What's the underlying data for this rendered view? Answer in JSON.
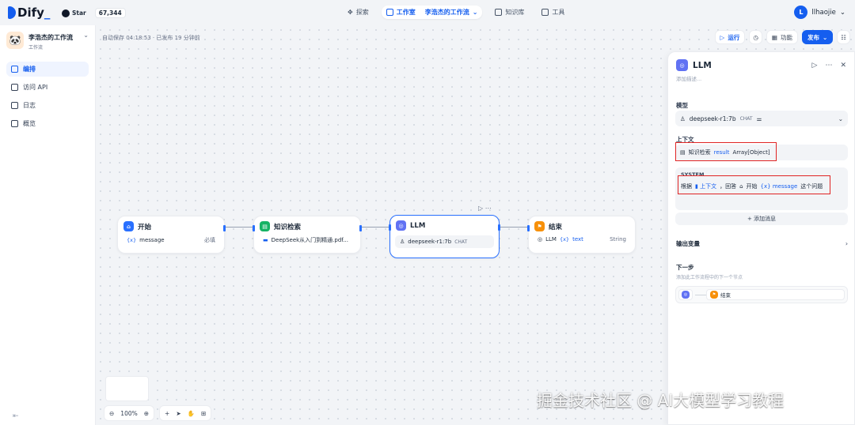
{
  "topbar": {
    "logo": "Dify",
    "github_star": "Star",
    "github_count": "67,344",
    "nav": [
      {
        "label": "探索",
        "icon": "compass-icon"
      },
      {
        "label": "工作室",
        "icon": "robot-icon",
        "sub": "李浩杰的工作流"
      },
      {
        "label": "知识库",
        "icon": "book-icon"
      },
      {
        "label": "工具",
        "icon": "briefcase-icon"
      }
    ],
    "user_initial": "L",
    "user_name": "llhaojie"
  },
  "sidebar": {
    "app_name": "李浩杰的工作流",
    "app_type": "工作流",
    "items": [
      {
        "label": "编排",
        "icon": "layout-icon",
        "active": true
      },
      {
        "label": "访问 API",
        "icon": "terminal-icon"
      },
      {
        "label": "日志",
        "icon": "file-icon"
      },
      {
        "label": "概览",
        "icon": "chart-icon"
      }
    ]
  },
  "canvas": {
    "autosave": "自动保存 04:18:53 · 已发布 19 分钟前",
    "run_label": "运行",
    "features_label": "功能",
    "publish_label": "发布",
    "zoom": "100%"
  },
  "nodes": {
    "start": {
      "title": "开始",
      "var_prefix": "{x}",
      "var_name": "message",
      "required": "必填",
      "color": "#2970ff"
    },
    "knowledge": {
      "title": "知识检索",
      "doc": "DeepSeek从入门到精通.pdf...",
      "color": "#16b364"
    },
    "llm": {
      "title": "LLM",
      "model": "deepseek-r1:7b",
      "tag": "CHAT",
      "color": "#6172f3"
    },
    "end": {
      "title": "结束",
      "var_src": "LLM",
      "var_prefix": "{x}",
      "var_name": "text",
      "type": "String",
      "color": "#f79009"
    }
  },
  "panel": {
    "title": "LLM",
    "desc": "添加描述...",
    "model_label": "模型",
    "model_name": "deepseek-r1:7b",
    "model_tag": "CHAT",
    "context_label": "上下文",
    "context_source": "知识检索",
    "context_var": "result",
    "context_type": "Array[Object]",
    "system_label": "SYSTEM",
    "sys_text1": "根据",
    "sys_ctx": "上下文",
    "sys_text2": "，回答",
    "sys_start": "开始",
    "sys_var": "{x} message",
    "sys_text3": "这个问题",
    "add_message": "+ 添加消息",
    "output_label": "输出变量",
    "next_label": "下一步",
    "next_desc": "添加此工作流程中的下一个节点",
    "next_node": "结束"
  },
  "watermark": "掘金技术社区 @ AI大模型学习教程"
}
